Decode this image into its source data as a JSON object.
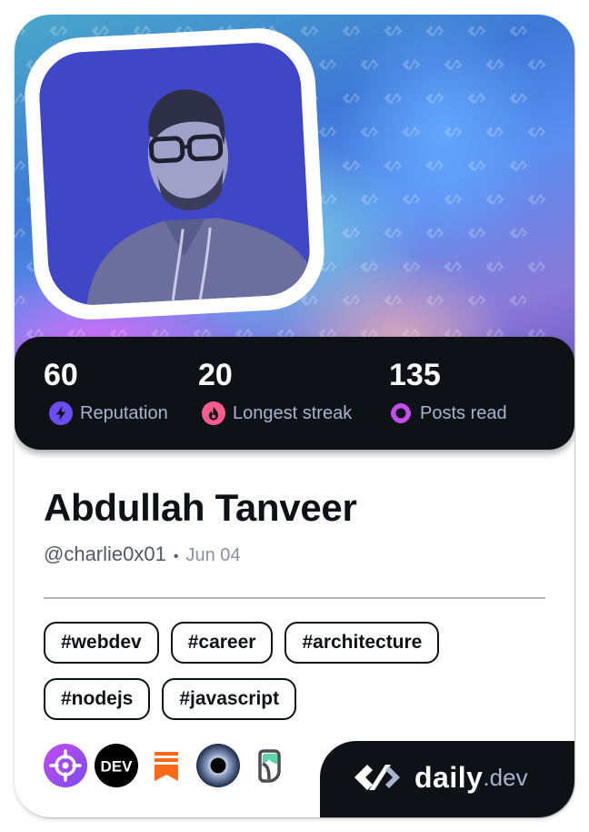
{
  "profile": {
    "name": "Abdullah Tanveer",
    "handle": "@charlie0x01",
    "separator": "•",
    "joined": "Jun 04"
  },
  "stats": [
    {
      "value": "60",
      "label": "Reputation",
      "icon": "lightning-icon",
      "color": "#6a4cf0"
    },
    {
      "value": "20",
      "label": "Longest streak",
      "icon": "flame-icon",
      "color": "#ff5a8f"
    },
    {
      "value": "135",
      "label": "Posts read",
      "icon": "eye-ring-icon",
      "color": "#c84df0"
    }
  ],
  "tags": [
    "#webdev",
    "#career",
    "#architecture",
    "#nodejs",
    "#javascript"
  ],
  "sources": [
    {
      "name": "target-source-icon",
      "color": "#a148f5"
    },
    {
      "name": "dev-to-icon",
      "label": "DEV",
      "color": "#000000"
    },
    {
      "name": "substack-icon",
      "color": "#ff6719"
    },
    {
      "name": "eclipse-icon",
      "color": "#1c2b4a"
    },
    {
      "name": "hashnode-leaf-icon",
      "color": "#5fd3a3"
    }
  ],
  "brand": {
    "word": "daily",
    "tld": ".dev"
  },
  "colors": {
    "dark": "#0e1217",
    "label": "#a8b3cf",
    "avatar_bg": "#3f47c6"
  }
}
